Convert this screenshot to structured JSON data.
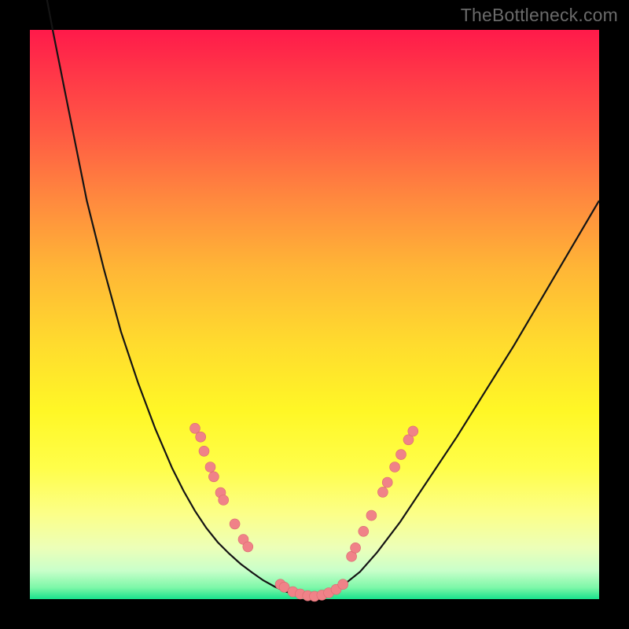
{
  "watermark": "TheBottleneck.com",
  "colors": {
    "frame": "#000000",
    "curve": "#141414",
    "marker_fill": "#f08288",
    "marker_stroke": "#d96a70"
  },
  "chart_data": {
    "type": "line",
    "title": "",
    "xlabel": "",
    "ylabel": "",
    "xlim": [
      0,
      100
    ],
    "ylim": [
      0,
      100
    ],
    "series": [
      {
        "name": "bottleneck-curve",
        "x": [
          0,
          1,
          2.5,
          4,
          6,
          8,
          10,
          13,
          16,
          19,
          22,
          25,
          27,
          29,
          31,
          33,
          35,
          37,
          39,
          41,
          43,
          45,
          47,
          49,
          51,
          53,
          55,
          58,
          61,
          65,
          70,
          75,
          80,
          85,
          90,
          95,
          100
        ],
        "y": [
          120,
          115,
          108,
          100,
          90,
          80,
          70,
          58,
          47,
          38,
          30,
          23,
          19,
          15.5,
          12.5,
          10,
          8,
          6.2,
          4.7,
          3.3,
          2.2,
          1.3,
          0.7,
          0.4,
          0.6,
          1.2,
          2.4,
          4.8,
          8.2,
          13.5,
          21,
          28.5,
          36.5,
          44.5,
          53,
          61.5,
          70
        ]
      }
    ],
    "markers": {
      "left_cluster": [
        {
          "x": 29,
          "y": 30
        },
        {
          "x": 30,
          "y": 28.5
        },
        {
          "x": 30.6,
          "y": 26
        },
        {
          "x": 31.7,
          "y": 23.2
        },
        {
          "x": 32.3,
          "y": 21.5
        },
        {
          "x": 33.5,
          "y": 18.7
        },
        {
          "x": 34,
          "y": 17.4
        },
        {
          "x": 36,
          "y": 13.2
        },
        {
          "x": 37.5,
          "y": 10.5
        },
        {
          "x": 38.3,
          "y": 9.2
        }
      ],
      "bottom_cluster": [
        {
          "x": 44,
          "y": 2.6
        },
        {
          "x": 44.7,
          "y": 2.1
        },
        {
          "x": 46.2,
          "y": 1.3
        },
        {
          "x": 47.5,
          "y": 0.9
        },
        {
          "x": 48.8,
          "y": 0.6
        },
        {
          "x": 50,
          "y": 0.5
        },
        {
          "x": 51.3,
          "y": 0.7
        },
        {
          "x": 52.5,
          "y": 1.1
        },
        {
          "x": 53.8,
          "y": 1.7
        },
        {
          "x": 55,
          "y": 2.6
        }
      ],
      "right_cluster": [
        {
          "x": 56.5,
          "y": 7.5
        },
        {
          "x": 57.2,
          "y": 9
        },
        {
          "x": 58.6,
          "y": 11.9
        },
        {
          "x": 60,
          "y": 14.7
        },
        {
          "x": 62,
          "y": 18.8
        },
        {
          "x": 62.8,
          "y": 20.5
        },
        {
          "x": 64.1,
          "y": 23.2
        },
        {
          "x": 65.2,
          "y": 25.4
        },
        {
          "x": 66.5,
          "y": 28
        },
        {
          "x": 67.3,
          "y": 29.5
        }
      ]
    }
  }
}
